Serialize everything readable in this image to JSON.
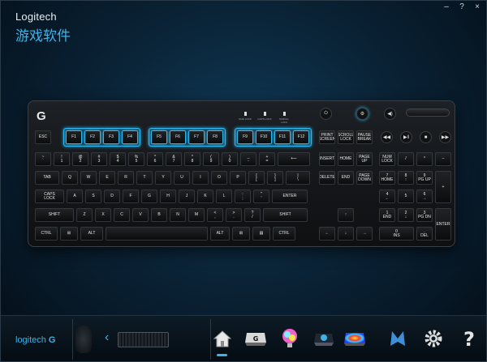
{
  "app": {
    "brand": "Logitech",
    "title": "游戏软件",
    "window_controls": [
      "–",
      "?",
      "×"
    ]
  },
  "keyboard": {
    "led_indicators": [
      "NUM LOCK",
      "CAPS LOCK",
      "SCROLL LOCK"
    ],
    "fkey_groups": [
      [
        "F1",
        "F2",
        "F3",
        "F4"
      ],
      [
        "F5",
        "F6",
        "F7",
        "F8"
      ],
      [
        "F9",
        "F10",
        "F11",
        "F12"
      ]
    ],
    "esc": "ESC",
    "nav_top": [
      "PRINT\nSCREEN",
      "SCROLL\nLOCK",
      "PAUSE\nBREAK"
    ],
    "row1": [
      "~\n`",
      "!\n1",
      "@\n2",
      "#\n3",
      "$\n4",
      "%\n5",
      "^\n6",
      "&\n7",
      "*\n8",
      "(\n9",
      ")\n0",
      "_\n-",
      "+\n="
    ],
    "backspace": "⟵",
    "nav_mid1": [
      "INSERT",
      "HOME",
      "PAGE\nUP"
    ],
    "num_row1": [
      "NUM\nLOCK",
      "/",
      "*",
      "–"
    ],
    "tab": "TAB",
    "row2": [
      "Q",
      "W",
      "E",
      "R",
      "T",
      "Y",
      "U",
      "I",
      "O",
      "P",
      "{\n[",
      "}\n]",
      "|\n\\"
    ],
    "nav_mid2": [
      "DELETE",
      "END",
      "PAGE\nDOWN"
    ],
    "num_row2": [
      "7\nHOME",
      "8\n↑",
      "9\nPG UP"
    ],
    "num_plus": "+",
    "caps": "CAPS\nLOCK",
    "row3": [
      "A",
      "S",
      "D",
      "F",
      "G",
      "H",
      "J",
      "K",
      "L",
      ":\n;",
      "\"\n'"
    ],
    "enter": "ENTER",
    "num_row3": [
      "4\n←",
      "5",
      "6\n→"
    ],
    "shift_l": "SHIFT",
    "row4": [
      "Z",
      "X",
      "C",
      "V",
      "B",
      "N",
      "M",
      "<\n,",
      ">\n.",
      "?\n/"
    ],
    "shift_r": "SHIFT",
    "arrow_up": "↑",
    "num_row4": [
      "1\nEND",
      "2\n↓",
      "3\nPG DN"
    ],
    "num_enter": "ENTER",
    "ctrl_l": "CTRL",
    "win_l": "⊞",
    "alt_l": "ALT",
    "space": "",
    "alt_r": "ALT",
    "win_r": "⊞",
    "menu": "▤",
    "ctrl_r": "CTRL",
    "arrows_bottom": [
      "←",
      "↓",
      "→"
    ],
    "num_row5": [
      "0\nINS",
      ".\nDEL"
    ],
    "media_buttons": [
      "◀◀",
      "▶‖",
      "■",
      "▶▶"
    ],
    "mode_buttons": [
      "⏻",
      "⚙",
      "◀)"
    ]
  },
  "bottom": {
    "brand": "logitech",
    "tools": [
      "home-icon",
      "g-key-icon",
      "lighting-icon",
      "gaming-mode-icon",
      "heatmap-icon",
      "logitech-g-icon",
      "settings-icon",
      "help-icon"
    ]
  },
  "colors": {
    "accent": "#3fb2ea",
    "background": "#0a2336"
  }
}
